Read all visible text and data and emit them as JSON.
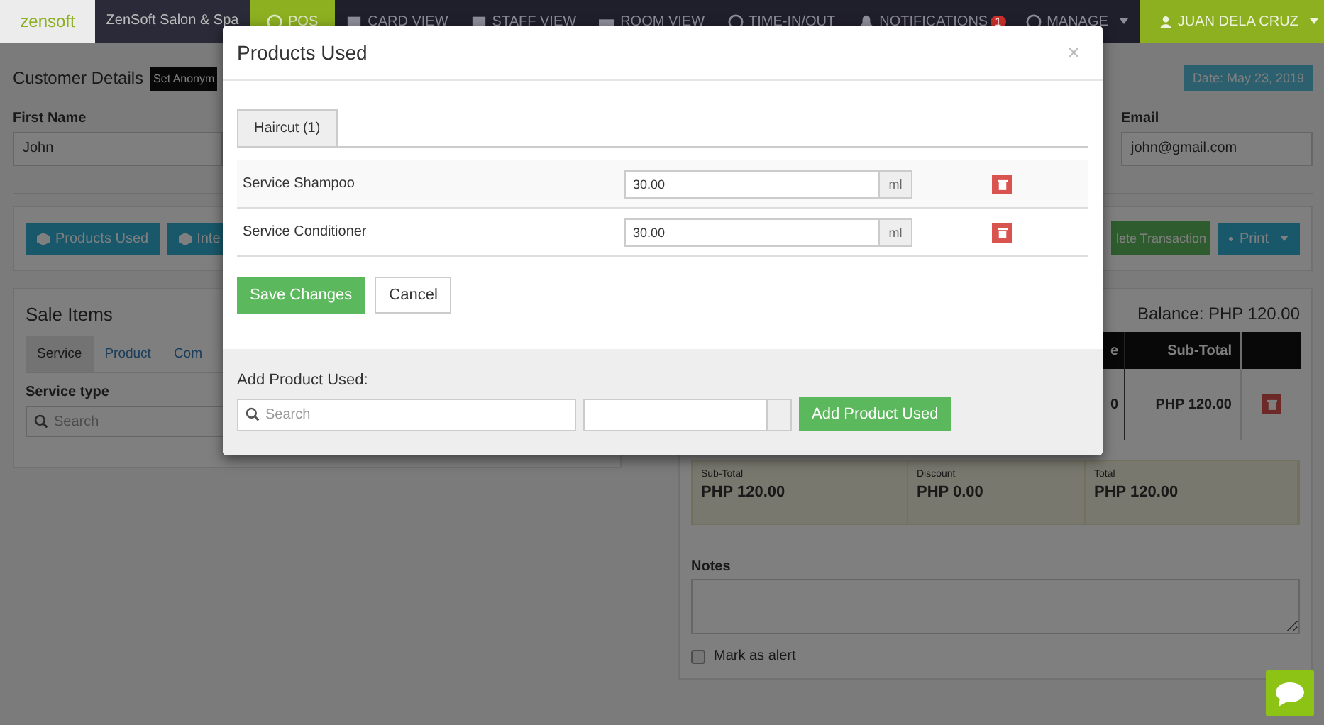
{
  "navbar": {
    "logo": "zensoft",
    "brand": "ZenSoft Salon & Spa",
    "items": [
      {
        "label": "POS",
        "selected": true
      },
      {
        "label": "CARD VIEW",
        "selected": false
      },
      {
        "label": "STAFF VIEW",
        "selected": false
      },
      {
        "label": "ROOM VIEW",
        "selected": false
      },
      {
        "label": "TIME-IN/OUT",
        "selected": false
      },
      {
        "label": "NOTIFICATIONS",
        "selected": false,
        "badge": "1"
      },
      {
        "label": "MANAGE",
        "selected": false,
        "dropdown": true
      }
    ],
    "user": "JUAN DELA CRUZ"
  },
  "customer": {
    "title": "Customer Details",
    "anonymous_button": "Set Anonym",
    "date": "Date: May 23, 2019",
    "fields": [
      {
        "label": "First Name",
        "value": "John"
      },
      {
        "label": "Email",
        "value": "john@gmail.com"
      }
    ]
  },
  "actions": {
    "left": [
      "Products Used",
      "Inte"
    ],
    "right": [
      {
        "label": "lete Transaction",
        "kind": "success"
      },
      {
        "label": "Print",
        "kind": "print"
      }
    ]
  },
  "sale_items": {
    "title": "Sale Items",
    "tabs": [
      {
        "label": "Service",
        "selected": true
      },
      {
        "label": "Product",
        "selected": false
      },
      {
        "label": "Com",
        "selected": false
      }
    ],
    "field_label": "Service type",
    "placeholder": "Search"
  },
  "summary": {
    "balance": "Balance: PHP 120.00",
    "columns": [
      "e",
      "Sub-Total"
    ],
    "rows": [
      {
        "cells": [
          "0",
          "PHP 120.00"
        ]
      }
    ],
    "totals": [
      {
        "label": "Sub-Total",
        "value": "PHP 120.00"
      },
      {
        "label": "Discount",
        "value": "PHP 0.00"
      },
      {
        "label": "Total",
        "value": "PHP 120.00"
      }
    ],
    "notes_label": "Notes",
    "alert": {
      "label": "Mark as alert",
      "checked": false
    }
  },
  "modal": {
    "title": "Products Used",
    "close": "×",
    "tabs": [
      {
        "label": "Haircut (1)",
        "selected": true
      }
    ],
    "items": [
      {
        "name": "Service Shampoo",
        "quantity": "30.00",
        "unit": "ml"
      },
      {
        "name": "Service Conditioner",
        "quantity": "30.00",
        "unit": "ml"
      }
    ],
    "save": "Save Changes",
    "cancel": "Cancel",
    "add_label": "Add Product Used:",
    "placeholder": "Search",
    "add_button": "Add Product Used"
  }
}
